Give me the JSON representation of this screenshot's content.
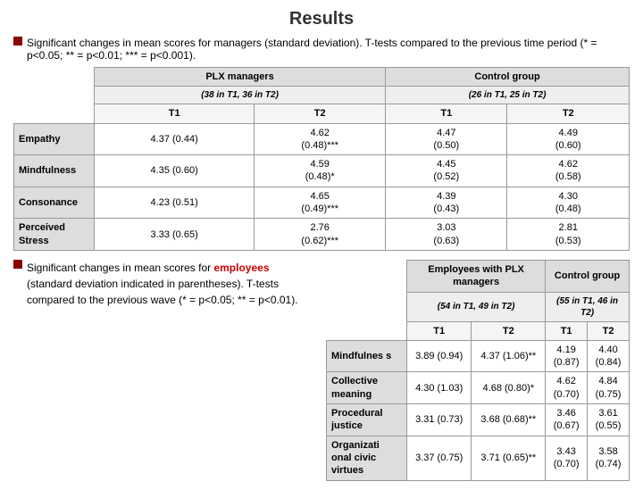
{
  "title": "Results",
  "intro": {
    "bullet_text": "Significant changes in mean scores for",
    "link_text": "managers",
    "rest_text": "(standard deviation). T-tests compared to the previous time period (* = p<0.05; ** = p<0.01; *** = p<0.001)."
  },
  "managers_table": {
    "group1_header": "PLX managers",
    "group1_subheader": "(38 in T1, 36 in T2)",
    "group2_header": "Control group",
    "group2_subheader": "(26 in T1, 25 in T2)",
    "col_t1": "T1",
    "col_t2": "T2",
    "rows": [
      {
        "label": "Empathy",
        "t1": "4.37 (0.44)",
        "t2": "4.62\n(0.48)***",
        "ct1": "4.47\n(0.50)",
        "ct2": "4.49\n(0.60)"
      },
      {
        "label": "Mindfulness",
        "t1": "4.35 (0.60)",
        "t2": "4.59\n(0.48)*",
        "ct1": "4.45\n(0.52)",
        "ct2": "4.62\n(0.58)"
      },
      {
        "label": "Consonance",
        "t1": "4.23 (0.51)",
        "t2": "4.65\n(0.49)***",
        "ct1": "4.39\n(0.43)",
        "ct2": "4.30\n(0.48)"
      },
      {
        "label": "Perceived\nStress",
        "t1": "3.33 (0.65)",
        "t2": "2.76\n(0.62)***",
        "ct1": "3.03\n(0.63)",
        "ct2": "2.81\n(0.53)"
      }
    ]
  },
  "employees_table": {
    "group1_header": "Employees with PLX managers",
    "group1_subheader": "(54 in T1, 49 in T2)",
    "group2_header": "Control group",
    "group2_subheader": "(55 in T1, 46 in T2)",
    "col_t1": "T1",
    "col_t2": "T2",
    "rows": [
      {
        "label": "Mindfulnes s",
        "t1": "3.89 (0.94)",
        "t2": "4.37 (1.06)**",
        "ct1": "4.19\n(0.87)",
        "ct2": "4.40\n(0.84)"
      },
      {
        "label": "Collective meaning",
        "t1": "4.30 (1.03)",
        "t2": "4.68 (0.80)*",
        "ct1": "4.62\n(0.70)",
        "ct2": "4.84\n(0.75)"
      },
      {
        "label": "Procedural justice",
        "t1": "3.31 (0.73)",
        "t2": "3.68 (0.68)**",
        "ct1": "3.46\n(0.67)",
        "ct2": "3.61\n(0.55)"
      },
      {
        "label": "Organizati onal civic virtues",
        "t1": "3.37 (0.75)",
        "t2": "3.71 (0.65)**",
        "ct1": "3.43\n(0.70)",
        "ct2": "3.58\n(0.74)"
      }
    ]
  },
  "bottom_text": {
    "bullet_text": "Significant changes in mean scores for",
    "link_text": "employees",
    "rest_text": "(standard deviation indicated in parentheses). T-tests compared to the previous wave (* = p<0.05; ** = p<0.01)."
  }
}
